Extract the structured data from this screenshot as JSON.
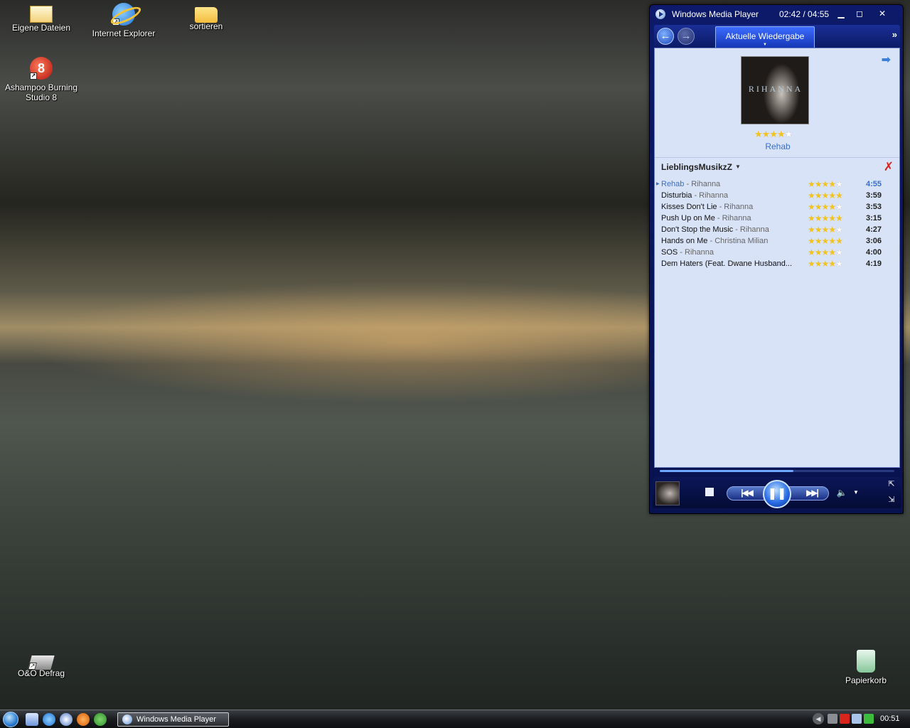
{
  "desktop": {
    "icons": [
      {
        "label": "Eigene Dateien",
        "icon": "mydocs-icon"
      },
      {
        "label": "Internet Explorer",
        "icon": "ie-icon"
      },
      {
        "label": "sortieren",
        "icon": "folder-icon"
      },
      {
        "label": "Ashampoo Burning Studio 8",
        "icon": "ashampoo-icon",
        "badge": "8"
      },
      {
        "label": "O&O Defrag",
        "icon": "defrag-icon"
      },
      {
        "label": "Papierkorb",
        "icon": "recycle-bin-icon"
      }
    ]
  },
  "wmp": {
    "title": "Windows Media Player",
    "time": "02:42 / 04:55",
    "window_buttons": {
      "minimize": "▁",
      "maximize": "◻",
      "close": "✕"
    },
    "nav": {
      "back": "←",
      "forward": "→",
      "tab": "Aktuelle Wiedergabe",
      "more": "»"
    },
    "now_playing": {
      "album_text": "RIHANNA",
      "title": "Rehab",
      "rating": 4,
      "max_rating": 5
    },
    "playlist": {
      "name": "LieblingsMusikzZ",
      "tracks": [
        {
          "title": "Rehab",
          "artist": " - Rihanna",
          "rating": 4,
          "duration": "4:55",
          "current": true
        },
        {
          "title": "Disturbia",
          "artist": " - Rihanna",
          "rating": 5,
          "duration": "3:59"
        },
        {
          "title": "Kisses Don't Lie",
          "artist": " - Rihanna",
          "rating": 4,
          "duration": "3:53"
        },
        {
          "title": "Push Up on Me",
          "artist": " - Rihanna",
          "rating": 5,
          "duration": "3:15"
        },
        {
          "title": "Don't Stop the Music",
          "artist": " - Rihanna",
          "rating": 4,
          "duration": "4:27"
        },
        {
          "title": "Hands on Me",
          "artist": " - Christina Milian",
          "rating": 5,
          "duration": "3:06"
        },
        {
          "title": "SOS",
          "artist": " - Rihanna",
          "rating": 4,
          "duration": "4:00"
        },
        {
          "title": "Dem Haters (Feat. Dwane Husband...",
          "artist": "",
          "rating": 4,
          "duration": "4:19"
        }
      ]
    },
    "progress_fraction": 0.57,
    "controls": {
      "prev": "|◀◀",
      "play_pause": "❚❚",
      "next": "▶▶|",
      "volume": "🔈",
      "vol_drop": "▼",
      "fullscreen": "⇱",
      "skin": "⇲"
    }
  },
  "taskbar": {
    "task_label": "Windows Media Player",
    "clock": "00:51",
    "tray_arrow": "◀"
  }
}
